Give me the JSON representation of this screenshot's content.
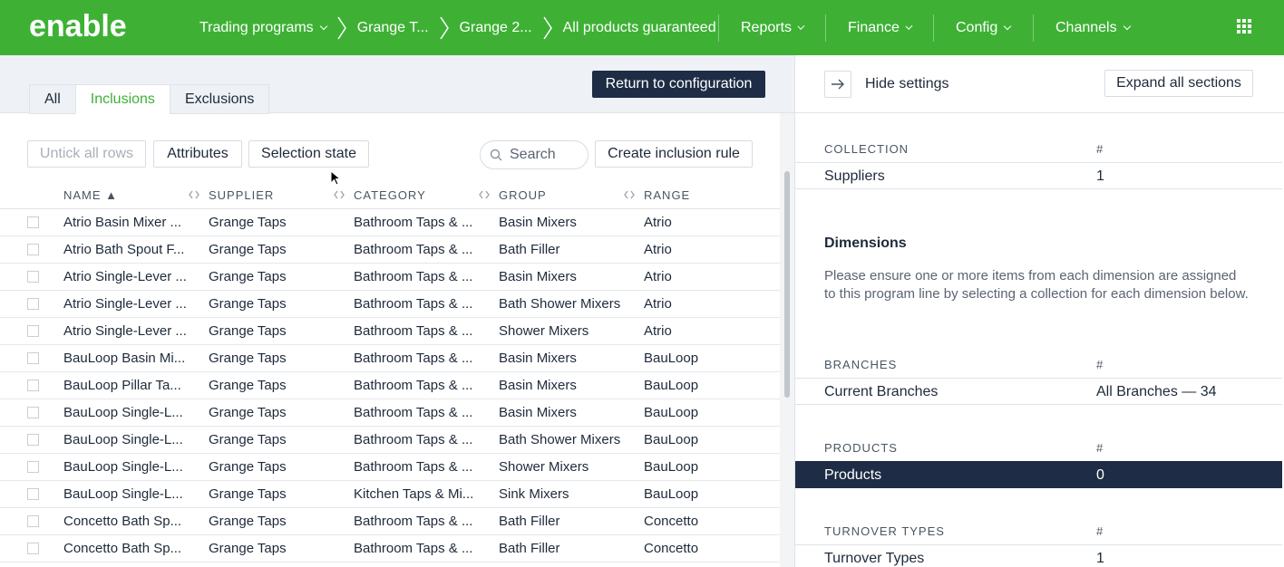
{
  "nav": {
    "logo_text": "enable",
    "crumbs": [
      "Trading programs",
      "Grange T...",
      "Grange 2...",
      "All products guaranteed"
    ],
    "menu": [
      "Reports",
      "Finance",
      "Config",
      "Channels"
    ]
  },
  "left": {
    "tabs": [
      "All",
      "Inclusions",
      "Exclusions"
    ],
    "return_button": "Return to configuration",
    "toolbar": {
      "untick": "Untick all rows",
      "attributes": "Attributes",
      "selection_state": "Selection state",
      "search_placeholder": "Search",
      "create_rule": "Create inclusion rule"
    },
    "columns": [
      "NAME ▲",
      "SUPPLIER",
      "CATEGORY",
      "GROUP",
      "RANGE"
    ],
    "rows": [
      [
        "Atrio Basin Mixer ...",
        "Grange Taps",
        "Bathroom Taps & ...",
        "Basin Mixers",
        "Atrio"
      ],
      [
        "Atrio Bath Spout F...",
        "Grange Taps",
        "Bathroom Taps & ...",
        "Bath Filler",
        "Atrio"
      ],
      [
        "Atrio Single-Lever ...",
        "Grange Taps",
        "Bathroom Taps & ...",
        "Basin Mixers",
        "Atrio"
      ],
      [
        "Atrio Single-Lever ...",
        "Grange Taps",
        "Bathroom Taps & ...",
        "Bath Shower Mixers",
        "Atrio"
      ],
      [
        "Atrio Single-Lever ...",
        "Grange Taps",
        "Bathroom Taps & ...",
        "Shower Mixers",
        "Atrio"
      ],
      [
        "BauLoop Basin Mi...",
        "Grange Taps",
        "Bathroom Taps & ...",
        "Basin Mixers",
        "BauLoop"
      ],
      [
        "BauLoop Pillar Ta...",
        "Grange Taps",
        "Bathroom Taps & ...",
        "Basin Mixers",
        "BauLoop"
      ],
      [
        "BauLoop Single-L...",
        "Grange Taps",
        "Bathroom Taps & ...",
        "Basin Mixers",
        "BauLoop"
      ],
      [
        "BauLoop Single-L...",
        "Grange Taps",
        "Bathroom Taps & ...",
        "Bath Shower Mixers",
        "BauLoop"
      ],
      [
        "BauLoop Single-L...",
        "Grange Taps",
        "Bathroom Taps & ...",
        "Shower Mixers",
        "BauLoop"
      ],
      [
        "BauLoop Single-L...",
        "Grange Taps",
        "Kitchen Taps & Mi...",
        "Sink Mixers",
        "BauLoop"
      ],
      [
        "Concetto Bath Sp...",
        "Grange Taps",
        "Bathroom Taps & ...",
        "Bath Filler",
        "Concetto"
      ],
      [
        "Concetto Bath Sp...",
        "Grange Taps",
        "Bathroom Taps & ...",
        "Bath Filler",
        "Concetto"
      ]
    ]
  },
  "right": {
    "hide_settings": "Hide settings",
    "expand_all": "Expand all sections",
    "collection": {
      "label": "COLLECTION",
      "hash": "#",
      "name": "Suppliers",
      "value": "1"
    },
    "dimensions": {
      "title": "Dimensions",
      "text": "Please ensure one or more items from each dimension are assigned to this program line by selecting a collection for each dimension below."
    },
    "branches": {
      "label": "BRANCHES",
      "hash": "#",
      "name": "Current Branches",
      "value": "All Branches — 34"
    },
    "products": {
      "label": "PRODUCTS",
      "hash": "#",
      "name": "Products",
      "value": "0"
    },
    "turnover": {
      "label": "TURNOVER TYPES",
      "hash": "#",
      "name": "Turnover Types",
      "value": "1"
    }
  },
  "colors": {
    "brand_green": "#3eb135",
    "navy": "#1e2d45"
  }
}
